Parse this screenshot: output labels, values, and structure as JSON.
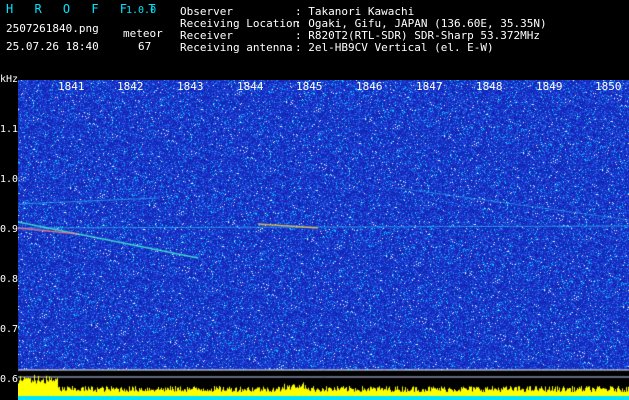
{
  "header": {
    "app_title": "H R O F F T",
    "version": "1.0.0",
    "filename": "2507261840.png",
    "datetime": "25.07.26 18:40",
    "meteor_label": "meteor",
    "meteor_count": "67",
    "fields": [
      {
        "label": "Observer",
        "value": ": Takanori Kawachi"
      },
      {
        "label": "Receiving Location",
        "value": ": Ogaki, Gifu, JAPAN (136.60E, 35.35N)"
      },
      {
        "label": "Receiver",
        "value": ": R820T2(RTL-SDR) SDR-Sharp 53.372MHz"
      },
      {
        "label": "Receiving antenna",
        "value": ": 2el-HB9CV Vertical (el. E-W)"
      }
    ]
  },
  "axes": {
    "y_unit": "kHz",
    "y_ticks": [
      "1.1",
      "1.0",
      "0.9",
      "0.8",
      "0.7",
      "0.6"
    ],
    "x_ticks": [
      "1841",
      "1842",
      "1843",
      "1844",
      "1845",
      "1846",
      "1847",
      "1848",
      "1849",
      "1850"
    ]
  },
  "colors": {
    "background": "#000000",
    "spectrogram_base": "#1a2fd0",
    "header_cyan": "#00e5ff",
    "level_bar": "#ffff00",
    "baseline": "#00e5ff"
  }
}
